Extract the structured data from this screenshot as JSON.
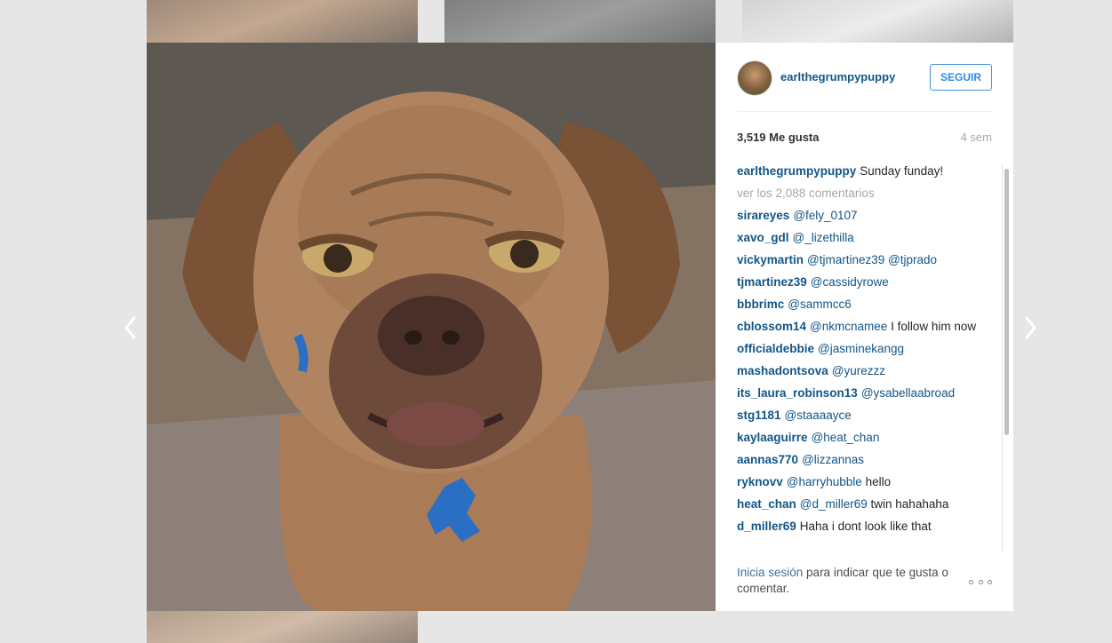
{
  "post": {
    "username": "earlthegrumpypuppy",
    "follow_label": "SEGUIR",
    "likes": "3,519 Me gusta",
    "age": "4 sem"
  },
  "caption": {
    "user": "earlthegrumpypuppy",
    "text": "Sunday funday!"
  },
  "view_all": "ver los 2,088 comentarios",
  "comments": [
    {
      "user": "sirareyes",
      "mention": "@fely_0107",
      "text": ""
    },
    {
      "user": "xavo_gdl",
      "mention": "@_lizethilla",
      "text": ""
    },
    {
      "user": "vickymartin",
      "mention": "@tjmartinez39 @tjprado",
      "text": ""
    },
    {
      "user": "tjmartinez39",
      "mention": "@cassidyrowe",
      "text": ""
    },
    {
      "user": "bbbrimc",
      "mention": "@sammcc6",
      "text": ""
    },
    {
      "user": "cblossom14",
      "mention": "@nkmcnamee",
      "text": "I follow him now"
    },
    {
      "user": "officialdebbie",
      "mention": "@jasminekangg",
      "text": ""
    },
    {
      "user": "mashadontsova",
      "mention": "@yurezzz",
      "text": ""
    },
    {
      "user": "its_laura_robinson13",
      "mention": "@ysabellaabroad",
      "text": ""
    },
    {
      "user": "stg1181",
      "mention": "@staaaayce",
      "text": ""
    },
    {
      "user": "kaylaaguirre",
      "mention": "@heat_chan",
      "text": ""
    },
    {
      "user": "aannas770",
      "mention": "@lizzannas",
      "text": ""
    },
    {
      "user": "ryknovv",
      "mention": "@harryhubble",
      "text": "hello"
    },
    {
      "user": "heat_chan",
      "mention": "@d_miller69",
      "text": "twin hahahaha"
    },
    {
      "user": "d_miller69",
      "mention": "",
      "text": "Haha i dont look like that"
    }
  ],
  "footer": {
    "login_link": "Inicia sesión",
    "login_rest": " para indicar que te gusta o comentar."
  },
  "icons": {
    "prev": "chevron-left-icon",
    "next": "chevron-right-icon",
    "more": "more-options-icon"
  },
  "colors": {
    "link": "#125688",
    "follow": "#2f8ae0",
    "muted": "#a5a7aa"
  }
}
